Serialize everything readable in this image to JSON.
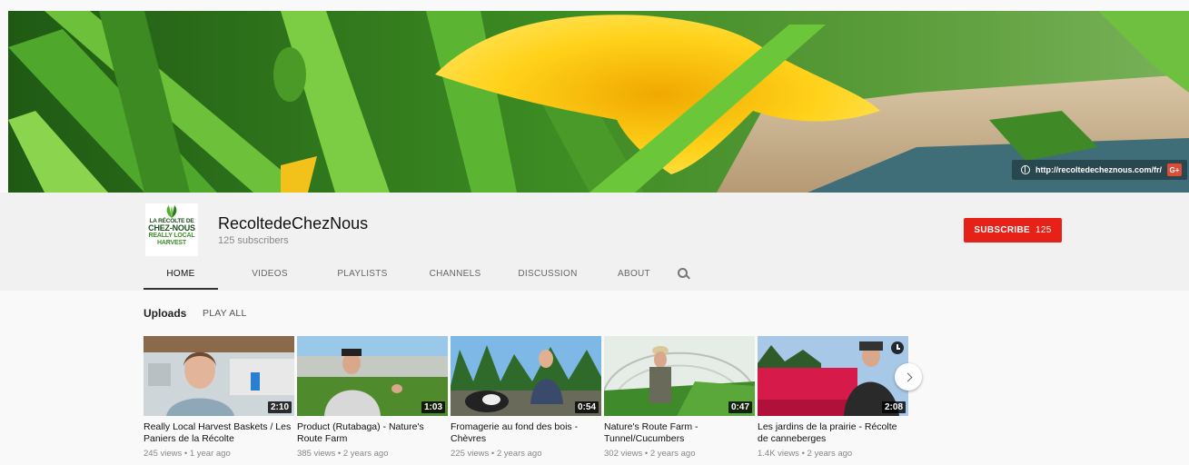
{
  "banner": {
    "url": "http://recoltedecheznous.com/fr/",
    "social_icon": "G+"
  },
  "channel": {
    "logo_lines": [
      "LA RÉCOLTE DE",
      "CHEZ-NOUS",
      "REALLY LOCAL",
      "HARVEST"
    ],
    "name": "RecoltedeChezNous",
    "subscribers": "125 subscribers"
  },
  "subscribe": {
    "label": "SUBSCRIBE",
    "count": "125",
    "color": "#e62117"
  },
  "tabs": [
    {
      "label": "HOME",
      "active": true
    },
    {
      "label": "VIDEOS",
      "active": false
    },
    {
      "label": "PLAYLISTS",
      "active": false
    },
    {
      "label": "CHANNELS",
      "active": false
    },
    {
      "label": "DISCUSSION",
      "active": false
    },
    {
      "label": "ABOUT",
      "active": false
    }
  ],
  "uploads": {
    "title": "Uploads",
    "play_all": "PLAY ALL",
    "videos": [
      {
        "title": "Really Local Harvest Baskets / Les Paniers de la Récolte",
        "duration": "2:10",
        "meta": "245 views • 1 year ago"
      },
      {
        "title": "Product (Rutabaga) - Nature's Route Farm",
        "duration": "1:03",
        "meta": "385 views • 2 years ago"
      },
      {
        "title": "Fromagerie au fond des bois - Chèvres",
        "duration": "0:54",
        "meta": "225 views • 2 years ago"
      },
      {
        "title": "Nature's Route Farm - Tunnel/Cucumbers",
        "duration": "0:47",
        "meta": "302 views • 2 years ago"
      },
      {
        "title": "Les jardins de la prairie - Récolte de canneberges",
        "duration": "2:08",
        "meta": "1.4K views • 2 years ago"
      }
    ]
  }
}
